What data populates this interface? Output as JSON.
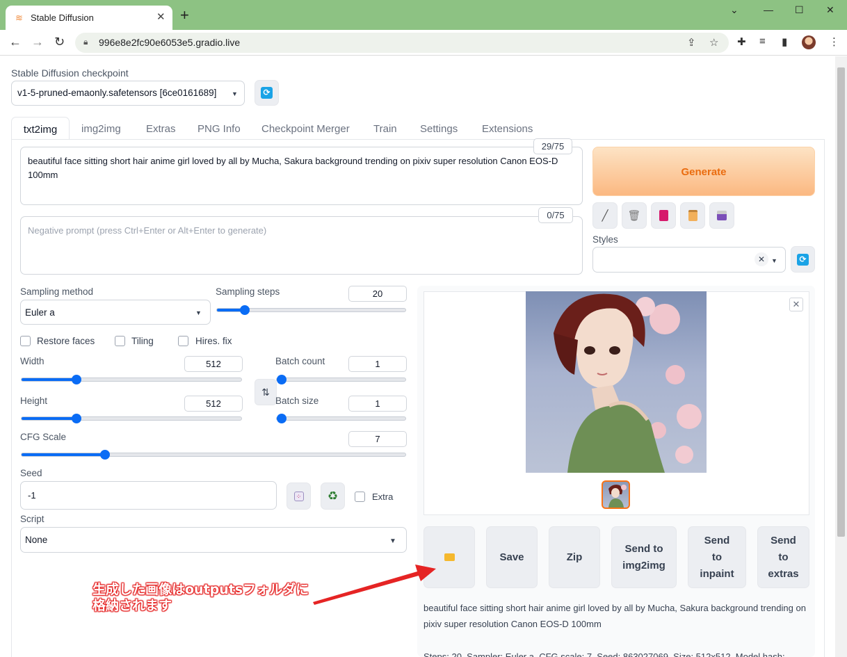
{
  "browser": {
    "tab_title": "Stable Diffusion",
    "url": "996e8e2fc90e6053e5.gradio.live"
  },
  "app": {
    "checkpoint_label": "Stable Diffusion checkpoint",
    "checkpoint_value": "v1-5-pruned-emaonly.safetensors [6ce0161689]",
    "tabs": [
      "txt2img",
      "img2img",
      "Extras",
      "PNG Info",
      "Checkpoint Merger",
      "Train",
      "Settings",
      "Extensions"
    ],
    "active_tab": "txt2img",
    "prompt": {
      "text": "beautiful face sitting short hair anime girl loved by all by Mucha, Sakura background trending on pixiv super resolution Canon EOS-D 100mm",
      "token_count": "29/75"
    },
    "negative_prompt": {
      "placeholder": "Negative prompt (press Ctrl+Enter or Alt+Enter to generate)",
      "token_count": "0/75"
    },
    "generate_label": "Generate",
    "styles_label": "Styles",
    "sampling_method": {
      "label": "Sampling method",
      "value": "Euler a"
    },
    "sampling_steps": {
      "label": "Sampling steps",
      "value": "20",
      "fraction": 0.13
    },
    "checkboxes": {
      "restore_faces": {
        "label": "Restore faces",
        "checked": false
      },
      "tiling": {
        "label": "Tiling",
        "checked": false
      },
      "hires_fix": {
        "label": "Hires. fix",
        "checked": false
      }
    },
    "width": {
      "label": "Width",
      "value": "512",
      "fraction": 0.24
    },
    "height": {
      "label": "Height",
      "value": "512",
      "fraction": 0.24
    },
    "batch_count": {
      "label": "Batch count",
      "value": "1",
      "fraction": 0.0
    },
    "batch_size": {
      "label": "Batch size",
      "value": "1",
      "fraction": 0.0
    },
    "cfg_scale": {
      "label": "CFG Scale",
      "value": "7",
      "fraction": 0.21
    },
    "seed": {
      "label": "Seed",
      "value": "-1",
      "extra_label": "Extra"
    },
    "script": {
      "label": "Script",
      "value": "None"
    },
    "output_buttons": {
      "folder_icon": "folder-icon",
      "save": "Save",
      "zip": "Zip",
      "send_img2img": [
        "Send to",
        "img2img"
      ],
      "send_inpaint": [
        "Send",
        "to",
        "inpaint"
      ],
      "send_extras": [
        "Send",
        "to",
        "extras"
      ]
    },
    "output_info": "beautiful face sitting short hair anime girl loved by all by Mucha, Sakura background trending on pixiv super resolution Canon EOS-D 100mm",
    "generation_info": "Steps: 20, Sampler: Euler a, CFG scale: 7, Seed: 863027069, Size: 512x512, Model hash:"
  },
  "annotation": {
    "line1": "生成した画像はoutputsフォルダに",
    "line2": "格納されます",
    "color": "#e52424"
  },
  "colors": {
    "titlebar": "#8dc283",
    "accent_blue": "#0a6cf5",
    "generate_orange": "#ea6c0f"
  }
}
